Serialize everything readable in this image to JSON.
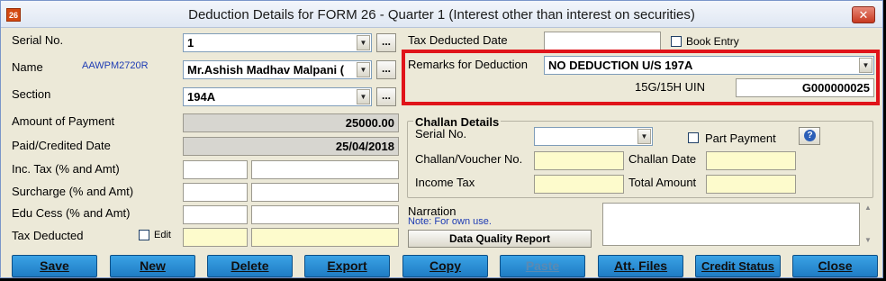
{
  "window": {
    "icon_text": "26",
    "title": "Deduction Details for FORM 26 - Quarter 1 (Interest other than interest on securities)",
    "close_symbol": "✕"
  },
  "left": {
    "serial_label": "Serial No.",
    "serial_value": "1",
    "name_label": "Name",
    "name_code": "AAWPM2720R",
    "name_value": "Mr.Ashish Madhav Malpani (",
    "section_label": "Section",
    "section_value": "194A",
    "amount_label": "Amount of Payment",
    "amount_value": "25000.00",
    "date_label": "Paid/Credited Date",
    "date_value": "25/04/2018",
    "inc_tax_label": "Inc. Tax (% and Amt)",
    "surcharge_label": "Surcharge (% and Amt)",
    "edu_cess_label": "Edu Cess (% and Amt)",
    "tax_deducted_label": "Tax Deducted",
    "edit_label": "Edit",
    "dots": "..."
  },
  "right": {
    "tax_deducted_date_label": "Tax Deducted Date",
    "book_entry_label": "Book Entry",
    "remarks_label": "Remarks for Deduction",
    "remarks_value": "NO DEDUCTION U/S 197A",
    "uin_label": "15G/15H UIN",
    "uin_value": "G000000025",
    "challan_title": "Challan Details",
    "challan_serial_label": "Serial No.",
    "part_payment_label": "Part Payment",
    "challan_voucher_label": "Challan/Voucher No.",
    "challan_date_label": "Challan Date",
    "income_tax_label": "Income Tax",
    "total_amount_label": "Total Amount",
    "narration_label": "Narration",
    "narration_note": "Note: For own use.",
    "data_quality_label": "Data Quality Report",
    "help_symbol": "?"
  },
  "buttons": {
    "save": "Save",
    "new": "New",
    "delete": "Delete",
    "export": "Export",
    "copy": "Copy",
    "paste": "Paste",
    "att_files": "Att. Files",
    "credit_status": "Credit Status",
    "close": "Close"
  },
  "icons": {
    "dropdown_arrow": "▼",
    "scroll_up": "▲",
    "scroll_down": "▼"
  },
  "colors": {
    "window_bg": "#ece9d8",
    "button_blue": "#2a8cd6",
    "highlight_red": "#e0141a",
    "yellow_field": "#fdfbcc"
  }
}
